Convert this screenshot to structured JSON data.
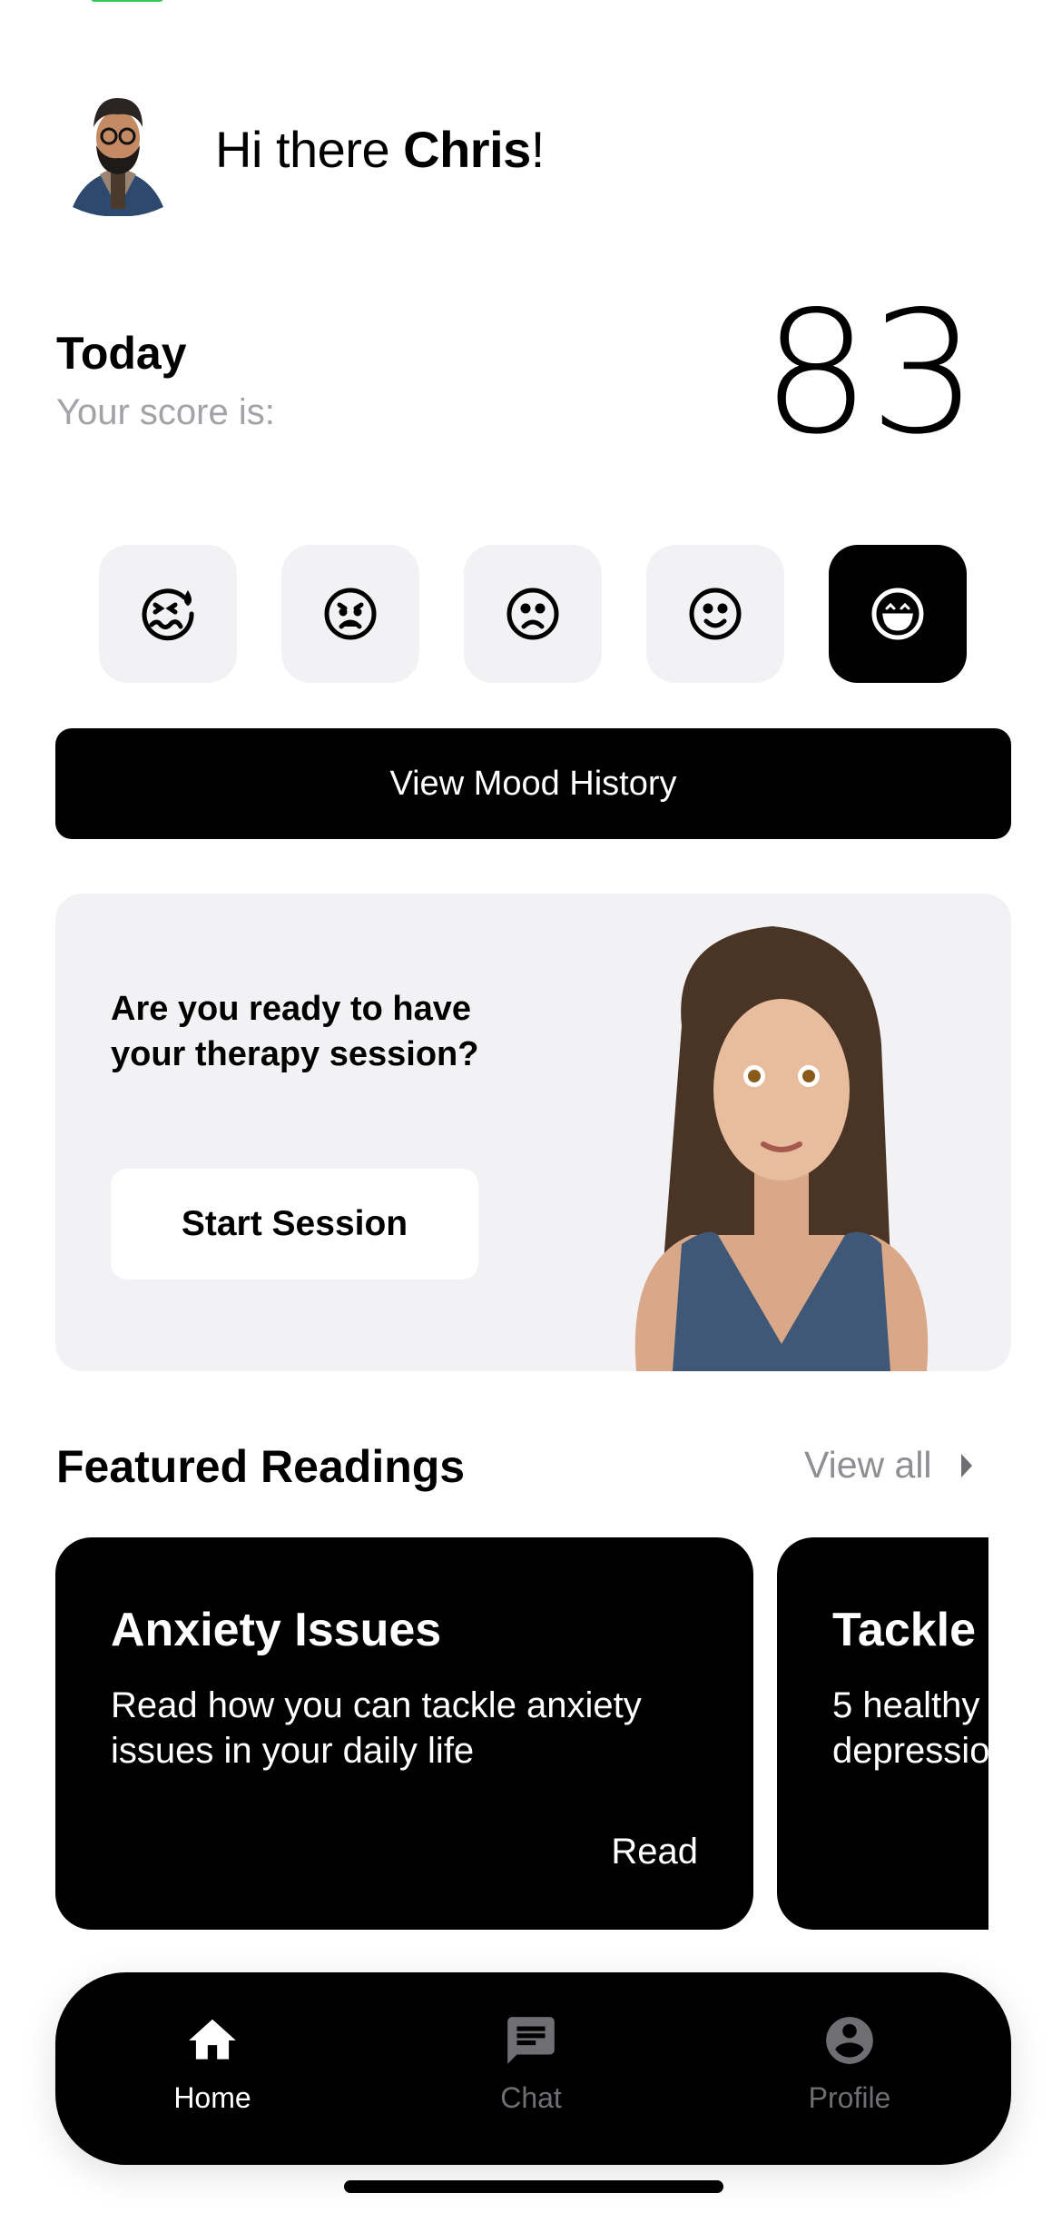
{
  "header": {
    "greeting_prefix": "Hi there ",
    "user_name": "Chris",
    "greeting_suffix": "!"
  },
  "score": {
    "heading": "Today",
    "label": "Your score is:",
    "value": "83"
  },
  "moods": [
    {
      "icon": "stressed-face-icon",
      "selected": false
    },
    {
      "icon": "angry-face-icon",
      "selected": false
    },
    {
      "icon": "sad-face-icon",
      "selected": false
    },
    {
      "icon": "smiling-face-icon",
      "selected": false
    },
    {
      "icon": "happy-face-icon",
      "selected": true
    }
  ],
  "mood_history_label": "View Mood History",
  "therapy": {
    "question": "Are you ready to have your therapy session?",
    "button": "Start Session"
  },
  "featured": {
    "title": "Featured Readings",
    "view_all": "View all",
    "cards": [
      {
        "title": "Anxiety Issues",
        "description": "Read how you can tackle anxiety issues in your daily life",
        "action": "Read"
      },
      {
        "title": "Tackle",
        "description": "5 healthy depressio"
      }
    ]
  },
  "nav": {
    "items": [
      {
        "label": "Home",
        "icon": "home-icon",
        "active": true
      },
      {
        "label": "Chat",
        "icon": "chat-icon",
        "active": false
      },
      {
        "label": "Profile",
        "icon": "profile-icon",
        "active": false
      }
    ]
  },
  "colors": {
    "accent": "#000000",
    "card_bg": "#f2f2f4",
    "muted": "#8e8e93",
    "inactive_tab": "#6e6e73"
  }
}
